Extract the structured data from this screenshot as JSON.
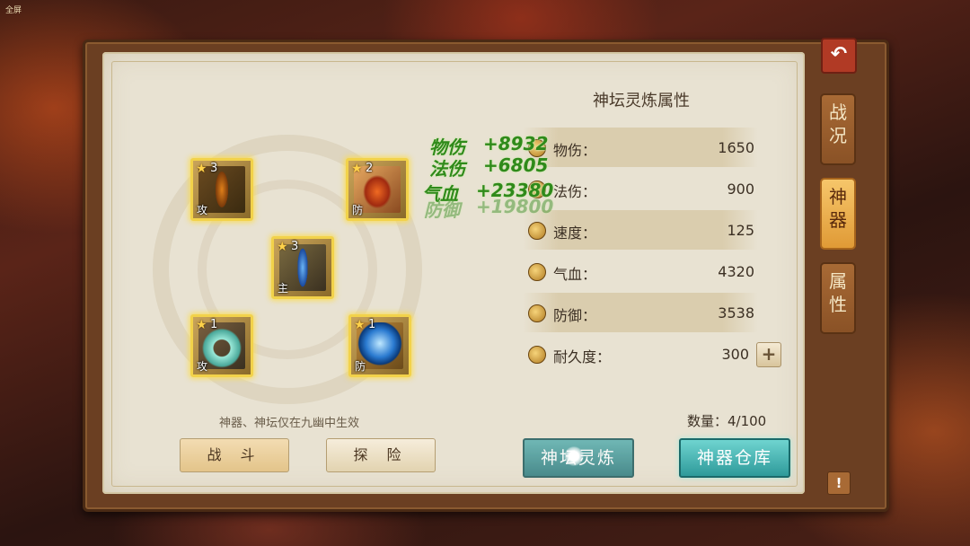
{
  "hud": {
    "top_left_label": "全屏"
  },
  "colors": {
    "panel": "#e8e2d2",
    "frame": "#6b3f22",
    "slot_glow": "#f2d24a",
    "teal_button": "#2e9a9a",
    "gain_text": "#2f8a1a"
  },
  "side_tabs": [
    {
      "label": "战况",
      "active": false
    },
    {
      "label": "神器",
      "active": true
    },
    {
      "label": "属性",
      "active": false
    }
  ],
  "back_icon": "back-arrow-icon",
  "artifact_slots": [
    {
      "stars": "3",
      "tag": "攻",
      "item": "flame-blade"
    },
    {
      "stars": "2",
      "tag": "防",
      "item": "fire-robe"
    },
    {
      "stars": "3",
      "tag": "主",
      "item": "blue-sword"
    },
    {
      "stars": "1",
      "tag": "攻",
      "item": "jade-ring"
    },
    {
      "stars": "1",
      "tag": "防",
      "item": "azure-orb"
    }
  ],
  "hint": "神器、神坛仅在九幽中生效",
  "buttons": {
    "battle": "战 斗",
    "explore": "探 险",
    "refine": "神坛灵炼",
    "warehouse": "神器仓库"
  },
  "attributes": {
    "title": "神坛灵炼属性",
    "rows": [
      {
        "name": "物伤：",
        "value": "1650",
        "icon": "sword-icon"
      },
      {
        "name": "法伤：",
        "value": "900",
        "icon": "magic-icon"
      },
      {
        "name": "速度：",
        "value": "125",
        "icon": "lightning-icon"
      },
      {
        "name": "气血：",
        "value": "4320",
        "icon": "heart-icon"
      },
      {
        "name": "防御：",
        "value": "3538",
        "icon": "shield-icon"
      },
      {
        "name": "耐久度：",
        "value": "300",
        "icon": "wrench-icon"
      }
    ]
  },
  "count": "数量：4/100",
  "floating_gains": [
    {
      "label": "物伤",
      "value": "+8932"
    },
    {
      "label": "法伤",
      "value": "+6805"
    },
    {
      "label": "气血",
      "value": "+23380"
    },
    {
      "label": "防御",
      "value": "+19800"
    }
  ]
}
